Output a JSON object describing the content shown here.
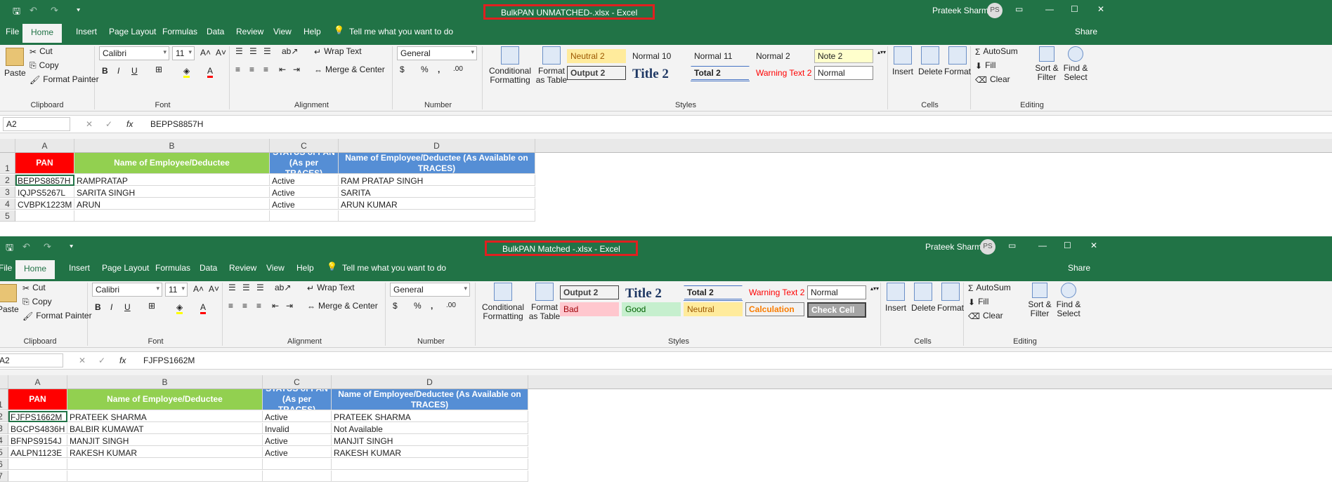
{
  "common": {
    "tabs": [
      "File",
      "Home",
      "Insert",
      "Page Layout",
      "Formulas",
      "Data",
      "Review",
      "View",
      "Help"
    ],
    "tell_me": "Tell me what you want to do",
    "share": "Share",
    "user": "Prateek Sharma",
    "initials": "PS",
    "clipboard": {
      "paste": "Paste",
      "cut": "Cut",
      "copy": "Copy",
      "format_painter": "Format Painter",
      "label": "Clipboard"
    },
    "font": {
      "name": "Calibri",
      "size": "11",
      "label": "Font",
      "bold": "B",
      "italic": "I",
      "underline": "U",
      "font_color_glyph": "A"
    },
    "alignment": {
      "wrap": "Wrap Text",
      "merge": "Merge & Center",
      "label": "Alignment"
    },
    "number": {
      "format": "General",
      "currency": "$",
      "percent": "%",
      "comma": ",",
      "inc": ".00",
      "label": "Number"
    },
    "styles": {
      "cond": "Conditional Formatting",
      "format_table": "Format as Table",
      "label": "Styles"
    },
    "cells": {
      "insert": "Insert",
      "delete": "Delete",
      "format": "Format",
      "label": "Cells"
    },
    "editing": {
      "autosum": "AutoSum",
      "fill": "Fill",
      "clear": "Clear",
      "sort": "Sort & Filter",
      "find": "Find & Select",
      "label": "Editing"
    },
    "headers": [
      "PAN",
      "Name of Employee/Deductee",
      "STATUS of PAN (As per TRACES)",
      "Name of Employee/Deductee (As Available on TRACES)"
    ],
    "columns": [
      "A",
      "B",
      "C",
      "D"
    ],
    "colors": {
      "excel_green": "#217346",
      "pan_header": "#ff0000",
      "name_header": "#92d050",
      "traces_header": "#558ed5"
    }
  },
  "window1": {
    "title": "BulkPAN UNMATCHED-.xlsx  -  Excel",
    "namebox": "A2",
    "formula": "BEPPS8857H",
    "styles": [
      [
        "Neutral 2",
        "Normal 10",
        "Normal 11",
        "Normal 2",
        "Note 2"
      ],
      [
        "Output 2",
        "Title 2",
        "Total 2",
        "Warning Text 2",
        "Normal"
      ]
    ],
    "row_numbers": [
      "1",
      "2",
      "3",
      "4",
      "5"
    ],
    "rows": [
      [
        "BEPPS8857H",
        "RAMPRATAP",
        "Active",
        "RAM PRATAP SINGH"
      ],
      [
        "IQJPS5267L",
        "SARITA SINGH",
        "Active",
        "SARITA"
      ],
      [
        "CVBPK1223M",
        "ARUN",
        "Active",
        "ARUN KUMAR"
      ]
    ]
  },
  "window2": {
    "title": "BulkPAN Matched -.xlsx  -  Excel",
    "namebox": "A2",
    "formula": "FJFPS1662M",
    "styles": [
      [
        "Output 2",
        "Title 2",
        "Total 2",
        "Warning Text 2",
        "Normal"
      ],
      [
        "Bad",
        "Good",
        "Neutral",
        "Calculation",
        "Check Cell"
      ]
    ],
    "row_numbers": [
      "1",
      "2",
      "3",
      "4",
      "5",
      "6",
      "7"
    ],
    "rows": [
      [
        "FJFPS1662M",
        "PRATEEK SHARMA",
        "Active",
        "PRATEEK SHARMA"
      ],
      [
        "BGCPS4836H",
        "BALBIR KUMAWAT",
        "Invalid",
        "Not Available"
      ],
      [
        "BFNPS9154J",
        "MANJIT SINGH",
        "Active",
        "MANJIT SINGH"
      ],
      [
        "AALPN1123E",
        "RAKESH KUMAR",
        "Active",
        "RAKESH KUMAR"
      ]
    ]
  }
}
